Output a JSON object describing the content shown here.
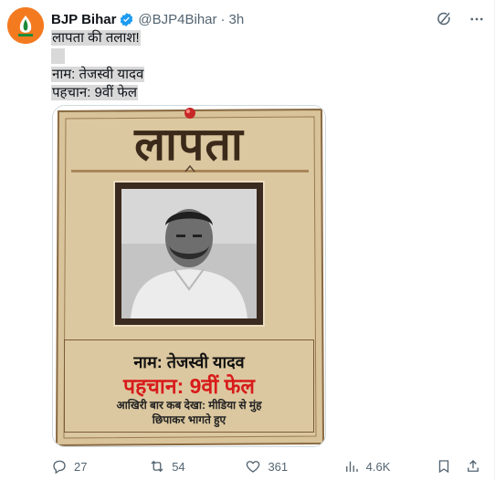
{
  "author": {
    "name": "BJP Bihar",
    "handle": "@BJP4Bihar",
    "separator": "·",
    "time": "3h"
  },
  "tweet": {
    "line1": "लापता की तलाश!",
    "line2": "नाम: तेजस्वी यादव",
    "line3": "पहचान: 9वीं फेल"
  },
  "poster": {
    "title": "लापता",
    "name": "नाम: तेजस्वी यादव",
    "identity": "पहचान: 9वीं फेल",
    "last_seen_1": "आखिरी बार कब देखा: मीडिया से मुंह",
    "last_seen_2": "छिपाकर भागते हुए"
  },
  "actions": {
    "replies": "27",
    "reposts": "54",
    "likes": "361",
    "views": "4.6K"
  },
  "colors": {
    "verified": "#1d9bf0",
    "poster_bg": "#d8c39a",
    "poster_red": "#d81b1b",
    "avatar_bg": "#f47a20"
  },
  "icons": [
    "verified-badge-icon",
    "grok-icon",
    "more-icon",
    "reply-icon",
    "repost-icon",
    "like-icon",
    "views-icon",
    "bookmark-icon",
    "share-icon",
    "push-pin-icon"
  ]
}
